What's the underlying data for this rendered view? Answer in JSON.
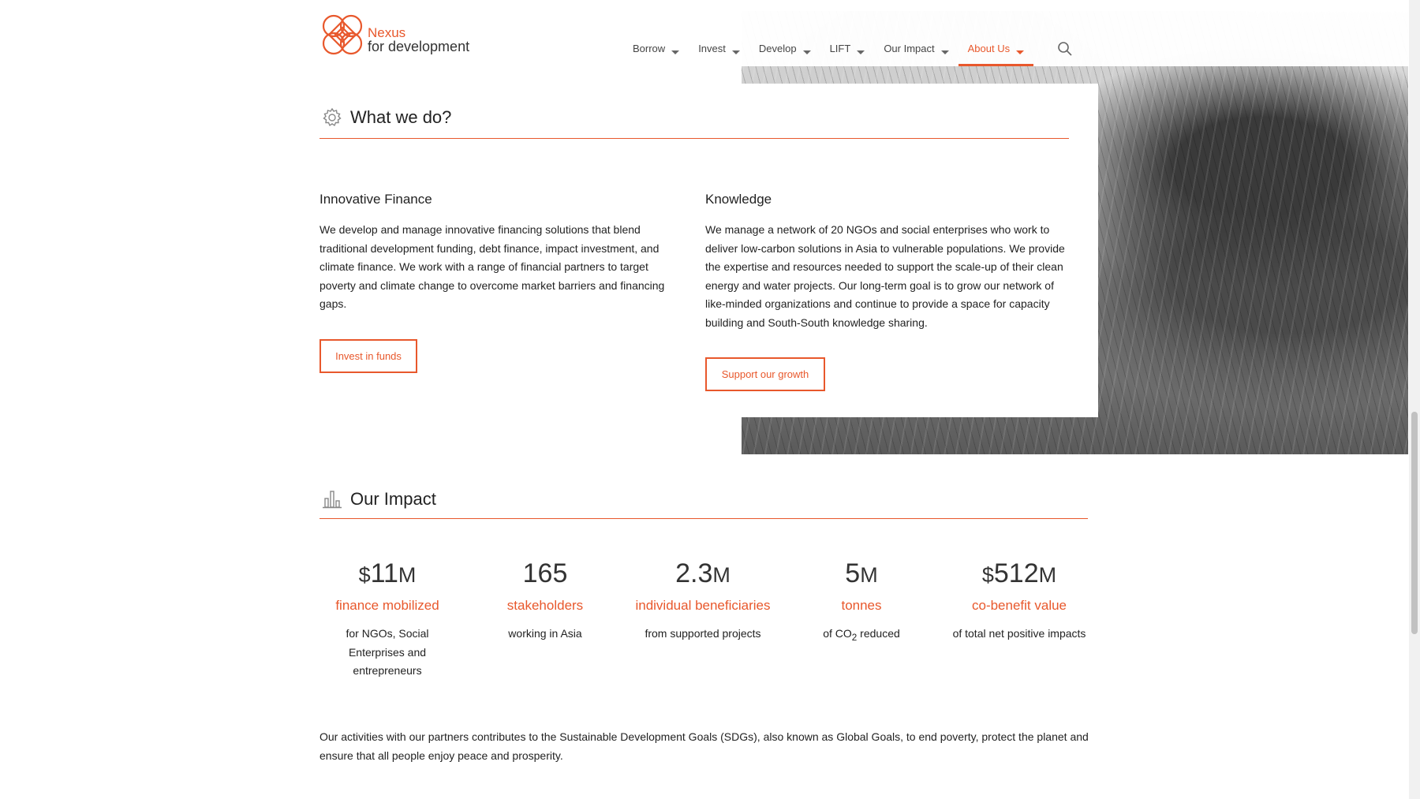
{
  "brand": {
    "line1": "Nexus",
    "line2": "for development",
    "accent": "#e8582c"
  },
  "nav": {
    "items": [
      {
        "label": "Borrow"
      },
      {
        "label": "Invest"
      },
      {
        "label": "Develop"
      },
      {
        "label": "LIFT"
      },
      {
        "label": "Our Impact"
      },
      {
        "label": "About Us",
        "active": true
      }
    ],
    "search_icon": "search-icon"
  },
  "what_we_do": {
    "title": "What we do?",
    "icon": "gear-icon",
    "columns": [
      {
        "title": "Innovative Finance",
        "text": "We develop and manage innovative financing solutions that blend traditional development funding, debt finance, impact investment, and climate finance. We work with a range of financial partners to target poverty and climate change to overcome market barriers and financing gaps.",
        "button": "Invest in funds"
      },
      {
        "title": "Knowledge",
        "text": "We manage a network of 20 NGOs and social enterprises who work to deliver low-carbon solutions in Asia to vulnerable populations. We provide the expertise and resources needed to support the scale-up of their clean energy and water projects. Our long-term goal is to grow our network of like-minded organizations and continue to provide a space for capacity building and South-South knowledge sharing.",
        "button": "Support our growth"
      }
    ]
  },
  "impact": {
    "title": "Our Impact",
    "icon": "bar-chart-icon",
    "stats": [
      {
        "prefix": "$",
        "value": "11",
        "unit": "M",
        "label": "finance mobilized",
        "desc": "for NGOs, Social Enterprises and entrepreneurs"
      },
      {
        "prefix": "",
        "value": "165",
        "unit": "",
        "label": "stakeholders",
        "desc": "working in Asia"
      },
      {
        "prefix": "",
        "value": "2.3",
        "unit": "M",
        "label": "individual beneficiaries",
        "desc": "from supported projects"
      },
      {
        "prefix": "",
        "value": "5",
        "unit": "M",
        "label": "tonnes",
        "desc_pre": "of CO",
        "desc_sub": "2",
        "desc_post": " reduced"
      },
      {
        "prefix": "$",
        "value": "512",
        "unit": "M",
        "label": "co-benefit value",
        "desc": "of total net positive impacts"
      }
    ],
    "sdg_text": "Our activities with our partners contributes to the Sustainable Development Goals (SDGs), also known as Global Goals, to end poverty, protect the planet and ensure that all people enjoy peace and prosperity."
  }
}
